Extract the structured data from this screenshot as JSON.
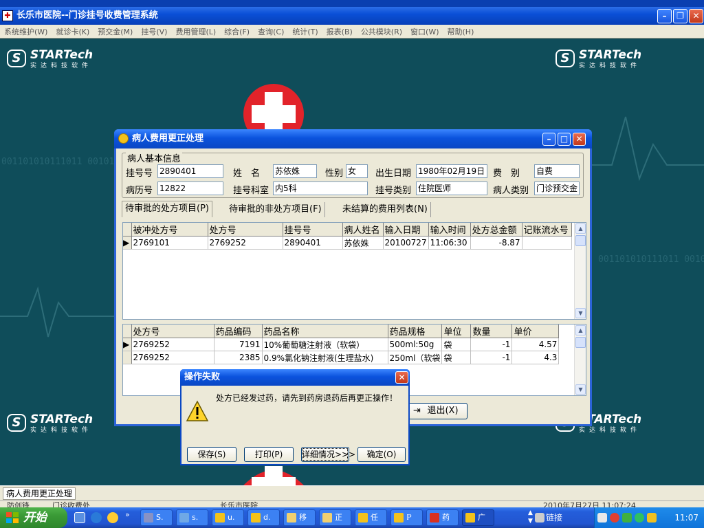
{
  "window": {
    "title": "长乐市医院--门诊挂号收费管理系统",
    "app_icon": "hospital-app-icon"
  },
  "menu": [
    "系统维护(W)",
    "就诊卡(K)",
    "预交金(M)",
    "挂号(V)",
    "费用管理(L)",
    "综合(F)",
    "查询(C)",
    "统计(T)",
    "报表(B)",
    "公共模块(R)",
    "窗口(W)",
    "帮助(H)"
  ],
  "logo": {
    "name": "STARTech",
    "sub": "实达科技软件"
  },
  "background": {
    "binary_text": "001101010111011 001010100011"
  },
  "dialog": {
    "title": "病人费用更正处理",
    "group_title": "病人基本信息",
    "labels": {
      "reg_no": "挂号号",
      "name": "姓　名",
      "sex": "性别",
      "dob": "出生日期",
      "fee_type": "费　别",
      "record_no": "病历号",
      "dept": "挂号科室",
      "reg_type": "挂号类别",
      "patient_type": "病人类别"
    },
    "values": {
      "reg_no": "2890401",
      "name": "苏依姝",
      "sex": "女",
      "dob": "1980年02月19日",
      "fee_type": "自费",
      "record_no": "12822",
      "dept": "内5科",
      "reg_type": "住院医师",
      "patient_type": "门诊预交金"
    },
    "tabs": [
      "待审批的处方项目(P)",
      "待审批的非处方项目(F)",
      "未结算的费用列表(N)"
    ],
    "grid1": {
      "columns": [
        "被冲处方号",
        "处方号",
        "挂号号",
        "病人姓名",
        "输入日期",
        "输入时间",
        "处方总金额",
        "记账流水号"
      ],
      "rows": [
        [
          "2769101",
          "2769252",
          "2890401",
          "苏依姝",
          "20100727",
          "11:06:30",
          "-8.87",
          ""
        ]
      ]
    },
    "grid2": {
      "columns": [
        "处方号",
        "药品编码",
        "药品名称",
        "药品规格",
        "单位",
        "数量",
        "单价"
      ],
      "rows": [
        [
          "2769252",
          "7191",
          "10%葡萄糖注射液（软袋）",
          "500ml:50g",
          "袋",
          "-1",
          "4.57"
        ],
        [
          "2769252",
          "2385",
          "0.9%氯化钠注射液(生理盐水)",
          "250ml（软袋",
          "袋",
          "-1",
          "4.3"
        ]
      ]
    },
    "exit_button": "退出(X)"
  },
  "error_dialog": {
    "title": "操作失败",
    "message": "处方已经发过药，请先到药房退药后再更正操作！",
    "buttons": {
      "save": "保存(S)",
      "print": "打印(P)",
      "details": "详细情况>>>",
      "ok": "确定(O)"
    }
  },
  "subwindow_bar": {
    "item": "病人费用更正处理"
  },
  "status_bar": {
    "left": "防创锋",
    "mid1": "门诊收费处",
    "mid2": "长乐市医院",
    "right": "2010年7月27日 11:07:24"
  },
  "taskbar": {
    "start": "开始",
    "tasks": [
      "S.",
      "s.",
      "u.",
      "d.",
      "移",
      "正",
      "任",
      "ℙ",
      "药",
      "广"
    ],
    "links": "链接",
    "clock": "11:07"
  },
  "colors": {
    "desktop": "#0f4d5a",
    "title_blue": "#0b53dd",
    "cross_red": "#e2232a"
  }
}
